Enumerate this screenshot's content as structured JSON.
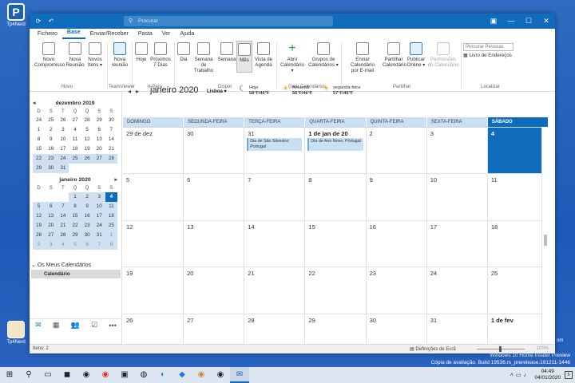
{
  "desktop": {
    "icon_top_label": "Tp4Nerd",
    "icon_bottom_label": "Tp4Nerd",
    "watermark_line1": "Windows 10 Home Insider Preview",
    "watermark_line2": "Cópia de avaliação. Build 19536.rs_prerelease.191211-1446",
    "badge_text": "om"
  },
  "titlebar": {
    "search_placeholder": "Procurar",
    "icons": [
      "refresh-icon",
      "undo-icon"
    ],
    "controls": [
      "restore-ribbon-icon",
      "minimize-icon",
      "maximize-icon",
      "close-icon"
    ]
  },
  "menu": [
    "Ficheiro",
    "Base",
    "Enviar/Receber",
    "Pasta",
    "Ver",
    "Ajuda"
  ],
  "ribbon": {
    "buttons": [
      {
        "label1": "Novo",
        "label2": "Compromisso"
      },
      {
        "label1": "Nova",
        "label2": "Reunião"
      },
      {
        "label1": "Novos",
        "label2": "Itens ▾"
      },
      {
        "label1": "Nova",
        "label2": "reunião"
      },
      {
        "label1": "Hoje",
        "label2": ""
      },
      {
        "label1": "Próximos",
        "label2": "7 Dias"
      },
      {
        "label1": "Dia",
        "label2": ""
      },
      {
        "label1": "Semana de",
        "label2": "Trabalho"
      },
      {
        "label1": "Semana",
        "label2": ""
      },
      {
        "label1": "Mês",
        "label2": ""
      },
      {
        "label1": "Vista de",
        "label2": "Agenda"
      },
      {
        "label1": "Abrir",
        "label2": "Calendário ▾"
      },
      {
        "label1": "Grupos de",
        "label2": "Calendários ▾"
      },
      {
        "label1": "Enviar Calendário",
        "label2": "por E-mail"
      },
      {
        "label1": "Partilhar",
        "label2": "Calendário"
      },
      {
        "label1": "Publicar",
        "label2": "Online ▾"
      },
      {
        "label1": "Permissões",
        "label2": "do Calendário"
      }
    ],
    "groups": [
      "Novo",
      "TeamViewer",
      "Ir Para",
      "Dispor",
      "Gerir Calendários",
      "Partilhar",
      "Localizar"
    ],
    "search_people_placeholder": "Procurar Pessoas",
    "address_book": "Livro de Endereços"
  },
  "minicals": [
    {
      "title": "dezembro 2019",
      "dows": [
        "D",
        "S",
        "T",
        "Q",
        "Q",
        "S",
        "S"
      ],
      "days": [
        "24",
        "25",
        "26",
        "27",
        "28",
        "29",
        "30",
        "1",
        "2",
        "3",
        "4",
        "5",
        "6",
        "7",
        "8",
        "9",
        "10",
        "11",
        "12",
        "13",
        "14",
        "15",
        "16",
        "17",
        "18",
        "19",
        "20",
        "21",
        "22",
        "23",
        "24",
        "25",
        "26",
        "27",
        "28",
        "29",
        "30",
        "31",
        "",
        "",
        "",
        ""
      ]
    },
    {
      "title": "janeiro 2020",
      "dows": [
        "D",
        "S",
        "T",
        "Q",
        "Q",
        "S",
        "S"
      ],
      "days": [
        "",
        "",
        "",
        "1",
        "2",
        "3",
        "4",
        "5",
        "6",
        "7",
        "8",
        "9",
        "10",
        "11",
        "12",
        "13",
        "14",
        "15",
        "16",
        "17",
        "18",
        "19",
        "20",
        "21",
        "22",
        "23",
        "24",
        "25",
        "26",
        "27",
        "28",
        "29",
        "30",
        "31",
        "1",
        "2",
        "3",
        "4",
        "5",
        "6",
        "7",
        "8"
      ]
    }
  ],
  "my_calendars": {
    "header": "Os Meus Calendários",
    "item": "Calendário"
  },
  "main": {
    "month_title": "janeiro 2020",
    "location": "Lisboa ▾",
    "weather": [
      {
        "day": "Hoje",
        "temp": "58°F/46°F",
        "icon": "moon-icon"
      },
      {
        "day": "Amanhã",
        "temp": "56°F/46°F",
        "icon": "sun-icon"
      },
      {
        "day": "segunda-feira",
        "temp": "57°F/46°F",
        "icon": "sun-icon"
      }
    ],
    "weekdays": [
      "DOMINGO",
      "SEGUNDA-FEIRA",
      "TERÇA-FEIRA",
      "QUARTA-FEIRA",
      "QUINTA-FEIRA",
      "SEXTA-FEIRA",
      "SÁBADO"
    ],
    "cells": [
      "29 de dez",
      "30",
      "31",
      "1 de jan de 20",
      "2",
      "3",
      "4",
      "5",
      "6",
      "7",
      "8",
      "9",
      "10",
      "11",
      "12",
      "13",
      "14",
      "15",
      "16",
      "17",
      "18",
      "19",
      "20",
      "21",
      "22",
      "23",
      "24",
      "25",
      "26",
      "27",
      "28",
      "29",
      "30",
      "31",
      "1 de fev"
    ],
    "events": [
      {
        "cell": 2,
        "text": "Dia de São Silvestre; Portugal"
      },
      {
        "cell": 3,
        "text": "Dia de Ano Novo; Portugal"
      }
    ]
  },
  "status": {
    "items": "Itens: 2",
    "display_settings": "Definições de Ecrã",
    "zoom": "100%"
  },
  "taskbar": {
    "time": "04:49",
    "date": "04/01/2020",
    "notif_count": "5"
  }
}
